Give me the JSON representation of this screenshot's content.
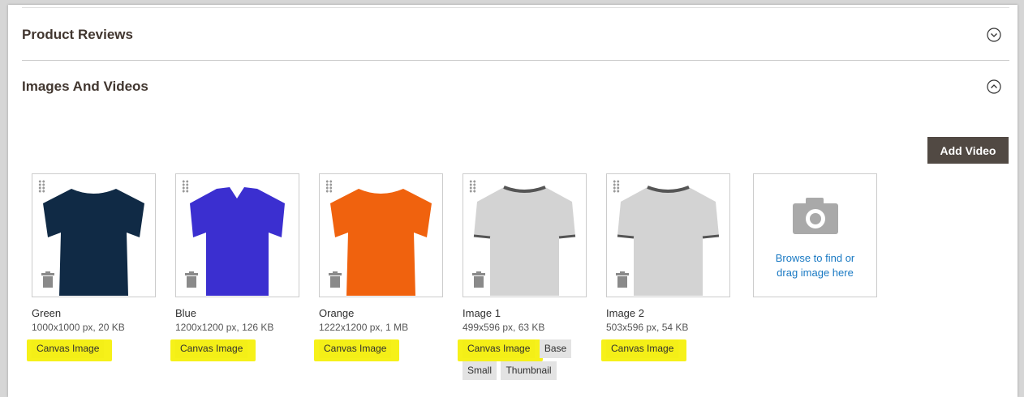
{
  "sections": {
    "reviews": {
      "title": "Product Reviews",
      "icon": "chevron-down-circle-icon"
    },
    "images": {
      "title": "Images And Videos",
      "icon": "chevron-up-circle-icon"
    }
  },
  "add_video_label": "Add Video",
  "uploader": {
    "text": "Browse to find or drag image here",
    "icon": "camera-icon"
  },
  "colors": {
    "highlight": "#f5f000",
    "button": "#514943",
    "link": "#1979c3"
  },
  "images": [
    {
      "name": "Green",
      "meta": "1000x1000 px, 20 KB",
      "shirt_color": "#102a45",
      "style": "tee",
      "roles": [
        "Canvas Image"
      ]
    },
    {
      "name": "Blue",
      "meta": "1200x1200 px, 126 KB",
      "shirt_color": "#3b2fd0",
      "style": "polo",
      "roles": [
        "Canvas Image"
      ]
    },
    {
      "name": "Orange",
      "meta": "1222x1200 px, 1 MB",
      "shirt_color": "#f0620e",
      "style": "tee",
      "roles": [
        "Canvas Image"
      ]
    },
    {
      "name": "Image 1",
      "meta": "499x596 px, 63 KB",
      "shirt_color": "#d3d3d3",
      "style": "ringer",
      "roles": [
        "Canvas Image",
        "Base",
        "Small",
        "Thumbnail"
      ]
    },
    {
      "name": "Image 2",
      "meta": "503x596 px, 54 KB",
      "shirt_color": "#d3d3d3",
      "style": "ringer",
      "roles": [
        "Canvas Image"
      ]
    }
  ]
}
